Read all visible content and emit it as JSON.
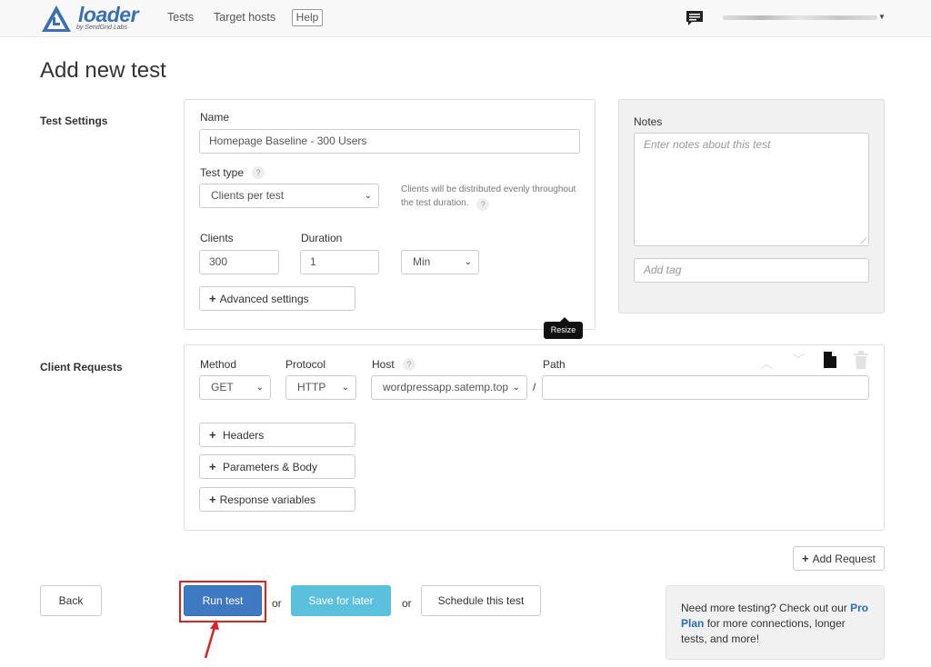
{
  "header": {
    "logo_text": "loader",
    "logo_sub": "by SendGrid Labs",
    "nav": [
      "Tests",
      "Target hosts"
    ],
    "help_label": "Help"
  },
  "page_title": "Add new test",
  "test_settings": {
    "section_label": "Test Settings",
    "name_label": "Name",
    "name_value": "Homepage Baseline - 300 Users",
    "test_type_label": "Test type",
    "test_type_value": "Clients per test",
    "test_type_help": "Clients will be distributed evenly throughout the test duration.",
    "clients_label": "Clients",
    "clients_value": "300",
    "duration_label": "Duration",
    "duration_value": "1",
    "duration_unit": "Min",
    "advanced_label": "Advanced settings",
    "resize_tooltip": "Resize"
  },
  "notes": {
    "label": "Notes",
    "placeholder": "Enter notes about this test",
    "tag_placeholder": "Add tag"
  },
  "client_requests": {
    "section_label": "Client Requests",
    "method_label": "Method",
    "method_value": "GET",
    "protocol_label": "Protocol",
    "protocol_value": "HTTP",
    "host_label": "Host",
    "host_value": "wordpressapp.satemp.top",
    "path_label": "Path",
    "path_separator": "/",
    "path_value": "",
    "headers_label": "Headers",
    "params_label": "Parameters & Body",
    "response_vars_label": "Response variables"
  },
  "add_request_label": "Add Request",
  "footer": {
    "back_label": "Back",
    "run_label": "Run test",
    "or1": "or",
    "save_label": "Save for later",
    "or2": "or",
    "schedule_label": "Schedule this test"
  },
  "promo": {
    "text_before": "Need more testing? Check out our",
    "link": "Pro Plan",
    "text_after": "for more connections, longer tests, and more!"
  },
  "colors": {
    "brand": "#3a6fb5",
    "run_button": "#3f79c2",
    "save_button": "#5bc0de",
    "highlight": "#e02020"
  }
}
